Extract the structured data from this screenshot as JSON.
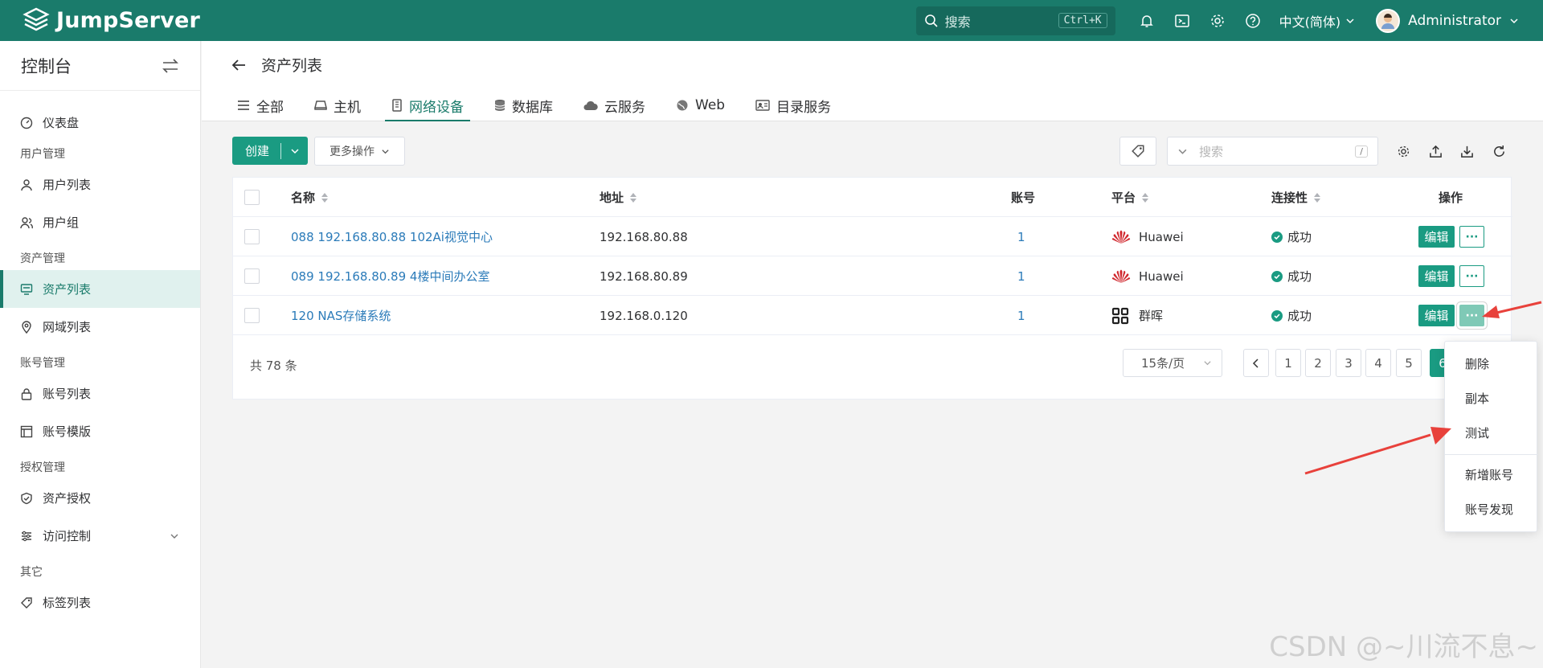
{
  "header": {
    "brand": "JumpServer",
    "search_placeholder": "搜索",
    "search_shortcut": "Ctrl+K",
    "language": "中文(简体)",
    "username": "Administrator"
  },
  "sidebar": {
    "title": "控制台",
    "sections": {
      "user_mgmt": "用户管理",
      "asset_mgmt": "资产管理",
      "account_mgmt": "账号管理",
      "perm_mgmt": "授权管理",
      "other": "其它"
    },
    "items": {
      "dashboard": "仪表盘",
      "user_list": "用户列表",
      "user_group": "用户组",
      "asset_list": "资产列表",
      "zone_list": "网域列表",
      "account_list": "账号列表",
      "account_template": "账号模版",
      "asset_perm": "资产授权",
      "access_control": "访问控制",
      "tag_list": "标签列表"
    }
  },
  "page": {
    "title": "资产列表",
    "tabs": [
      "全部",
      "主机",
      "网络设备",
      "数据库",
      "云服务",
      "Web",
      "目录服务"
    ],
    "active_tab": "网络设备"
  },
  "toolbar": {
    "create": "创建",
    "more_actions": "更多操作",
    "search_placeholder": "搜索",
    "search_slash": "/"
  },
  "table": {
    "columns": [
      "名称",
      "地址",
      "账号",
      "平台",
      "连接性",
      "操作"
    ],
    "rows": [
      {
        "name": "088 192.168.80.88 102Ai视觉中心",
        "address": "192.168.80.88",
        "accounts": "1",
        "platform": "Huawei",
        "status": "成功"
      },
      {
        "name": "089 192.168.80.89 4楼中间办公室",
        "address": "192.168.80.89",
        "accounts": "1",
        "platform": "Huawei",
        "status": "成功"
      },
      {
        "name": "120 NAS存储系统",
        "address": "192.168.0.120",
        "accounts": "1",
        "platform": "群晖",
        "status": "成功"
      }
    ],
    "edit_label": "编辑",
    "more_label": "···"
  },
  "pagination": {
    "total": "共 78 条",
    "page_size": "15条/页",
    "pages": [
      "1",
      "2",
      "3",
      "4",
      "5",
      "6"
    ],
    "current": "6"
  },
  "action_menu": {
    "items": [
      "删除",
      "副本",
      "测试",
      "新增账号",
      "账号发现"
    ]
  },
  "watermark": "CSDN @~川流不息~",
  "colors": {
    "brand": "#1a7b6b",
    "primary": "#1a9b82",
    "link": "#2b7bb9",
    "arrow": "#e8413b"
  }
}
